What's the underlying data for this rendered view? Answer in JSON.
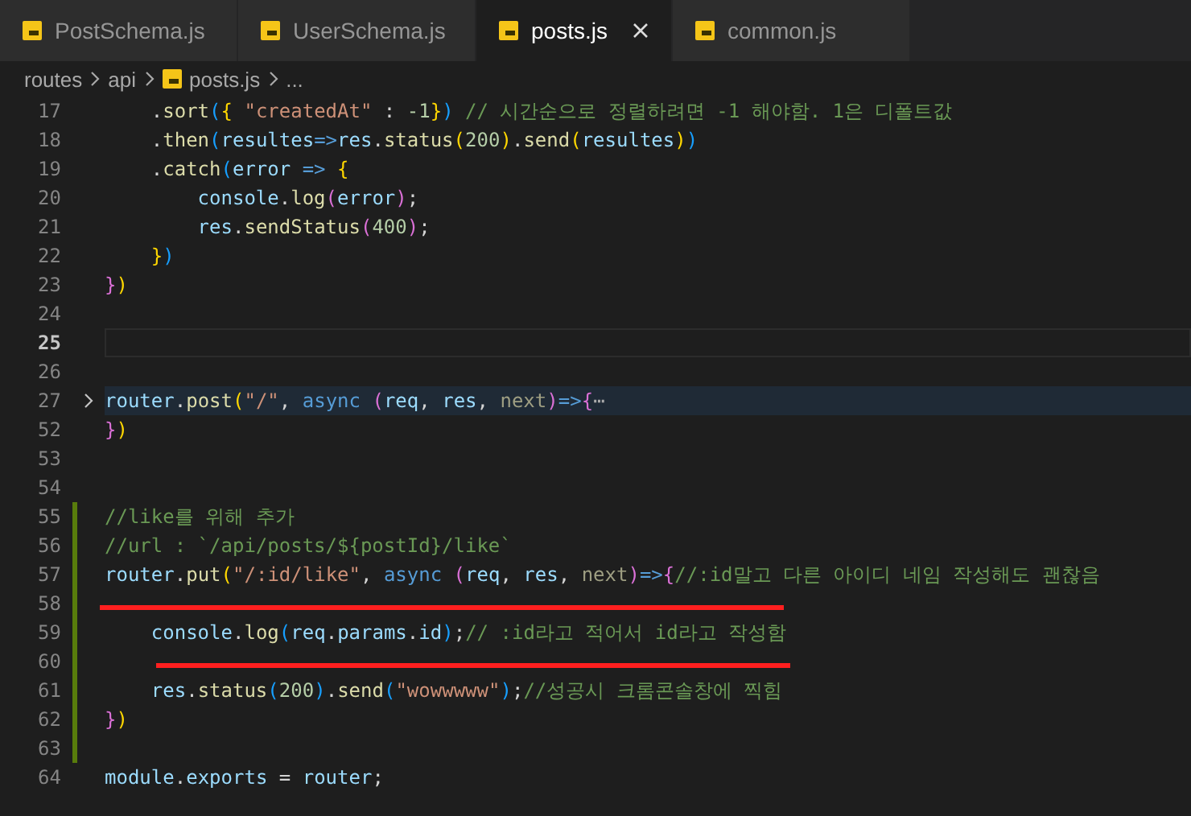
{
  "tabs": [
    {
      "label": "PostSchema.js",
      "selected": false
    },
    {
      "label": "UserSchema.js",
      "selected": false
    },
    {
      "label": "posts.js",
      "selected": true
    },
    {
      "label": "common.js",
      "selected": false
    }
  ],
  "breadcrumbs": [
    {
      "kind": "folder",
      "label": "routes"
    },
    {
      "kind": "folder",
      "label": "api"
    },
    {
      "kind": "file",
      "label": "posts.js"
    },
    {
      "kind": "more",
      "label": "..."
    }
  ],
  "lines": [
    {
      "number": "17",
      "current": false,
      "folded": false,
      "modified": false,
      "tokens": [
        {
          "kind": "p",
          "text": "    ."
        },
        {
          "kind": "fn",
          "text": "sort"
        },
        {
          "kind": "b3",
          "text": "("
        },
        {
          "kind": "b1",
          "text": "{"
        },
        {
          "kind": "str",
          "text": " \"createdAt\""
        },
        {
          "kind": "p",
          "text": " : "
        },
        {
          "kind": "num",
          "text": "-1"
        },
        {
          "kind": "b1",
          "text": "}"
        },
        {
          "kind": "b3",
          "text": ")"
        },
        {
          "kind": "cm",
          "text": " // 시간순으로 정렬하려면 -1 해야함. 1은 디폴트값"
        }
      ]
    },
    {
      "number": "18",
      "current": false,
      "folded": false,
      "modified": false,
      "tokens": [
        {
          "kind": "p",
          "text": "    ."
        },
        {
          "kind": "fn",
          "text": "then"
        },
        {
          "kind": "b3",
          "text": "("
        },
        {
          "kind": "var",
          "text": "resultes"
        },
        {
          "kind": "kw",
          "text": "=>"
        },
        {
          "kind": "var",
          "text": "res"
        },
        {
          "kind": "p",
          "text": "."
        },
        {
          "kind": "fn",
          "text": "status"
        },
        {
          "kind": "b1",
          "text": "("
        },
        {
          "kind": "num",
          "text": "200"
        },
        {
          "kind": "b1",
          "text": ")"
        },
        {
          "kind": "p",
          "text": "."
        },
        {
          "kind": "fn",
          "text": "send"
        },
        {
          "kind": "b1",
          "text": "("
        },
        {
          "kind": "var",
          "text": "resultes"
        },
        {
          "kind": "b1",
          "text": ")"
        },
        {
          "kind": "b3",
          "text": ")"
        }
      ]
    },
    {
      "number": "19",
      "current": false,
      "folded": false,
      "modified": false,
      "tokens": [
        {
          "kind": "p",
          "text": "    ."
        },
        {
          "kind": "fn",
          "text": "catch"
        },
        {
          "kind": "b3",
          "text": "("
        },
        {
          "kind": "var",
          "text": "error"
        },
        {
          "kind": "kw",
          "text": " => "
        },
        {
          "kind": "b1",
          "text": "{"
        }
      ]
    },
    {
      "number": "20",
      "current": false,
      "folded": false,
      "modified": false,
      "tokens": [
        {
          "kind": "var",
          "text": "        console"
        },
        {
          "kind": "p",
          "text": "."
        },
        {
          "kind": "fn",
          "text": "log"
        },
        {
          "kind": "b2",
          "text": "("
        },
        {
          "kind": "var",
          "text": "error"
        },
        {
          "kind": "b2",
          "text": ")"
        },
        {
          "kind": "p",
          "text": ";"
        }
      ]
    },
    {
      "number": "21",
      "current": false,
      "folded": false,
      "modified": false,
      "tokens": [
        {
          "kind": "var",
          "text": "        res"
        },
        {
          "kind": "p",
          "text": "."
        },
        {
          "kind": "fn",
          "text": "sendStatus"
        },
        {
          "kind": "b2",
          "text": "("
        },
        {
          "kind": "num",
          "text": "400"
        },
        {
          "kind": "b2",
          "text": ")"
        },
        {
          "kind": "p",
          "text": ";"
        }
      ]
    },
    {
      "number": "22",
      "current": false,
      "folded": false,
      "modified": false,
      "tokens": [
        {
          "kind": "b1",
          "text": "    }"
        },
        {
          "kind": "b3",
          "text": ")"
        }
      ]
    },
    {
      "number": "23",
      "current": false,
      "folded": false,
      "modified": false,
      "tokens": [
        {
          "kind": "b2",
          "text": "}"
        },
        {
          "kind": "b1",
          "text": ")"
        }
      ]
    },
    {
      "number": "24",
      "current": false,
      "folded": false,
      "modified": false
    },
    {
      "number": "25",
      "current": true,
      "folded": false,
      "modified": false
    },
    {
      "number": "26",
      "current": false,
      "folded": false,
      "modified": false
    },
    {
      "number": "27",
      "current": false,
      "folded": true,
      "modified": false,
      "tokens": [
        {
          "kind": "var",
          "text": "router"
        },
        {
          "kind": "p",
          "text": "."
        },
        {
          "kind": "fn",
          "text": "post"
        },
        {
          "kind": "b1",
          "text": "("
        },
        {
          "kind": "str",
          "text": "\"/\""
        },
        {
          "kind": "p",
          "text": ", "
        },
        {
          "kind": "kw",
          "text": "async"
        },
        {
          "kind": "b2",
          "text": " ("
        },
        {
          "kind": "var",
          "text": "req"
        },
        {
          "kind": "p",
          "text": ", "
        },
        {
          "kind": "var",
          "text": "res"
        },
        {
          "kind": "p",
          "text": ", "
        },
        {
          "kind": "unused",
          "text": "next"
        },
        {
          "kind": "b2",
          "text": ")"
        },
        {
          "kind": "kw",
          "text": "=>"
        },
        {
          "kind": "b2",
          "text": "{"
        },
        {
          "kind": "fold",
          "text": "⋯"
        }
      ]
    },
    {
      "number": "52",
      "current": false,
      "folded": false,
      "modified": false,
      "tokens": [
        {
          "kind": "b2",
          "text": "}"
        },
        {
          "kind": "b1",
          "text": ")"
        }
      ]
    },
    {
      "number": "53",
      "current": false,
      "folded": false,
      "modified": false
    },
    {
      "number": "54",
      "current": false,
      "folded": false,
      "modified": false
    },
    {
      "number": "55",
      "current": false,
      "folded": false,
      "modified": true,
      "tokens": [
        {
          "kind": "cm",
          "text": "//like를 위해 추가"
        }
      ]
    },
    {
      "number": "56",
      "current": false,
      "folded": false,
      "modified": true,
      "tokens": [
        {
          "kind": "cm",
          "text": "//url : `/api/posts/${postId}/like`"
        }
      ]
    },
    {
      "number": "57",
      "current": false,
      "folded": false,
      "modified": true,
      "tokens": [
        {
          "kind": "var",
          "text": "router"
        },
        {
          "kind": "p",
          "text": "."
        },
        {
          "kind": "fn",
          "text": "put"
        },
        {
          "kind": "b1",
          "text": "("
        },
        {
          "kind": "str",
          "text": "\"/:id/like\""
        },
        {
          "kind": "p",
          "text": ", "
        },
        {
          "kind": "kw",
          "text": "async"
        },
        {
          "kind": "b2",
          "text": " ("
        },
        {
          "kind": "var",
          "text": "req"
        },
        {
          "kind": "p",
          "text": ", "
        },
        {
          "kind": "var",
          "text": "res"
        },
        {
          "kind": "p",
          "text": ", "
        },
        {
          "kind": "unused",
          "text": "next"
        },
        {
          "kind": "b2",
          "text": ")"
        },
        {
          "kind": "kw",
          "text": "=>"
        },
        {
          "kind": "b2",
          "text": "{"
        },
        {
          "kind": "cm",
          "text": "//:id말고 다른 아이디 네임 작성해도 괜찮음"
        }
      ]
    },
    {
      "number": "58",
      "current": false,
      "folded": false,
      "modified": true
    },
    {
      "number": "59",
      "current": false,
      "folded": false,
      "modified": true,
      "tokens": [
        {
          "kind": "var",
          "text": "    console"
        },
        {
          "kind": "p",
          "text": "."
        },
        {
          "kind": "fn",
          "text": "log"
        },
        {
          "kind": "b3",
          "text": "("
        },
        {
          "kind": "var",
          "text": "req"
        },
        {
          "kind": "p",
          "text": "."
        },
        {
          "kind": "var",
          "text": "params"
        },
        {
          "kind": "p",
          "text": "."
        },
        {
          "kind": "var",
          "text": "id"
        },
        {
          "kind": "b3",
          "text": ")"
        },
        {
          "kind": "p",
          "text": ";"
        },
        {
          "kind": "cm",
          "text": "// :id라고 적어서 id라고 작성함"
        }
      ]
    },
    {
      "number": "60",
      "current": false,
      "folded": false,
      "modified": true
    },
    {
      "number": "61",
      "current": false,
      "folded": false,
      "modified": true,
      "tokens": [
        {
          "kind": "var",
          "text": "    res"
        },
        {
          "kind": "p",
          "text": "."
        },
        {
          "kind": "fn",
          "text": "status"
        },
        {
          "kind": "b3",
          "text": "("
        },
        {
          "kind": "num",
          "text": "200"
        },
        {
          "kind": "b3",
          "text": ")"
        },
        {
          "kind": "p",
          "text": "."
        },
        {
          "kind": "fn",
          "text": "send"
        },
        {
          "kind": "b3",
          "text": "("
        },
        {
          "kind": "str",
          "text": "\"wowwwww\""
        },
        {
          "kind": "b3",
          "text": ")"
        },
        {
          "kind": "p",
          "text": ";"
        },
        {
          "kind": "cm",
          "text": "//성공시 크롬콘솔창에 찍힘"
        }
      ]
    },
    {
      "number": "62",
      "current": false,
      "folded": false,
      "modified": true,
      "tokens": [
        {
          "kind": "b2",
          "text": "}"
        },
        {
          "kind": "b1",
          "text": ")"
        }
      ]
    },
    {
      "number": "63",
      "current": false,
      "folded": false,
      "modified": true
    },
    {
      "number": "64",
      "current": false,
      "folded": false,
      "modified": false,
      "tokens": [
        {
          "kind": "var",
          "text": "module"
        },
        {
          "kind": "p",
          "text": "."
        },
        {
          "kind": "var",
          "text": "exports"
        },
        {
          "kind": "p",
          "text": " = "
        },
        {
          "kind": "var",
          "text": "router"
        },
        {
          "kind": "p",
          "text": ";"
        }
      ]
    }
  ]
}
